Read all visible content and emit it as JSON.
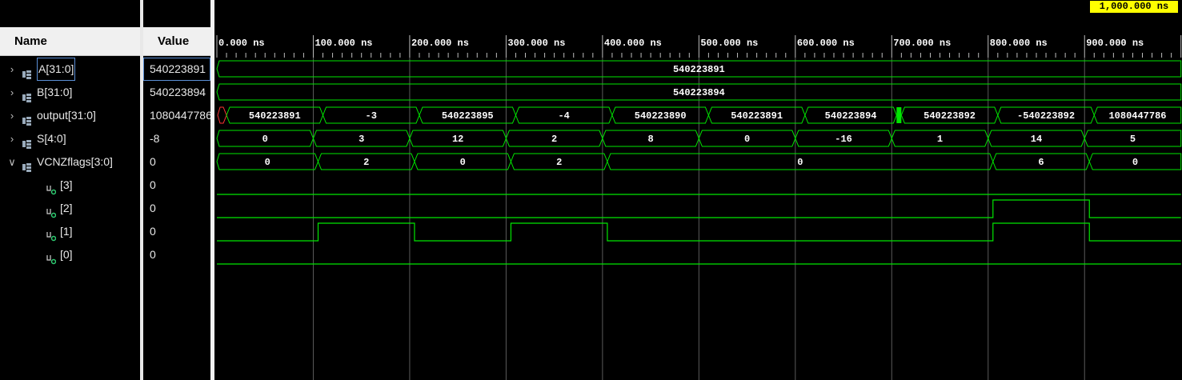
{
  "header": {
    "name_label": "Name",
    "value_label": "Value"
  },
  "cursor": {
    "time_label": "1,000.000 ns"
  },
  "timeline": {
    "unit": "ns",
    "start": 0,
    "end": 1000,
    "ticks": [
      "0.000 ns",
      "100.000 ns",
      "200.000 ns",
      "300.000 ns",
      "400.000 ns",
      "500.000 ns",
      "600.000 ns",
      "700.000 ns",
      "800.000 ns",
      "900.000 ns"
    ]
  },
  "colors": {
    "wave": "#00e600",
    "bg": "#000000",
    "grid": "#5a5a5a",
    "cursor_bg": "#ffff00",
    "x_state": "#ff3333",
    "selection": "#5b8fd6"
  },
  "icons": {
    "bus": "bus-signal-icon",
    "bit": "bit-signal-icon",
    "expand": "chevron-right-icon",
    "collapse": "chevron-down-icon"
  },
  "signals": [
    {
      "name": "A[31:0]",
      "value": "540223891",
      "kind": "bus",
      "expanded": false,
      "selected": true,
      "segments": [
        {
          "t0": 0,
          "t1": 1000,
          "label": "540223891"
        }
      ]
    },
    {
      "name": "B[31:0]",
      "value": "540223894",
      "kind": "bus",
      "expanded": false,
      "segments": [
        {
          "t0": 0,
          "t1": 1000,
          "label": "540223894"
        }
      ]
    },
    {
      "name": "output[31:0]",
      "value": "1080447786",
      "kind": "bus",
      "expanded": false,
      "segments": [
        {
          "t0": 0,
          "t1": 10,
          "label": "",
          "state": "X"
        },
        {
          "t0": 10,
          "t1": 110,
          "label": "540223891"
        },
        {
          "t0": 110,
          "t1": 210,
          "label": "-3"
        },
        {
          "t0": 210,
          "t1": 310,
          "label": "540223895"
        },
        {
          "t0": 310,
          "t1": 410,
          "label": "-4"
        },
        {
          "t0": 410,
          "t1": 510,
          "label": "540223890"
        },
        {
          "t0": 510,
          "t1": 610,
          "label": "540223891"
        },
        {
          "t0": 610,
          "t1": 705,
          "label": "540223894"
        },
        {
          "t0": 705,
          "t1": 710,
          "label": "",
          "state": "glitch"
        },
        {
          "t0": 710,
          "t1": 810,
          "label": "540223892"
        },
        {
          "t0": 810,
          "t1": 910,
          "label": "-540223892"
        },
        {
          "t0": 910,
          "t1": 1000,
          "label": "1080447786"
        }
      ]
    },
    {
      "name": "S[4:0]",
      "value": "-8",
      "kind": "bus",
      "expanded": false,
      "segments": [
        {
          "t0": 0,
          "t1": 100,
          "label": "0"
        },
        {
          "t0": 100,
          "t1": 200,
          "label": "3"
        },
        {
          "t0": 200,
          "t1": 300,
          "label": "12"
        },
        {
          "t0": 300,
          "t1": 400,
          "label": "2"
        },
        {
          "t0": 400,
          "t1": 500,
          "label": "8"
        },
        {
          "t0": 500,
          "t1": 600,
          "label": "0"
        },
        {
          "t0": 600,
          "t1": 700,
          "label": "-16"
        },
        {
          "t0": 700,
          "t1": 800,
          "label": "1"
        },
        {
          "t0": 800,
          "t1": 900,
          "label": "14"
        },
        {
          "t0": 900,
          "t1": 1000,
          "label": "5"
        }
      ]
    },
    {
      "name": "VCNZflags[3:0]",
      "value": "0",
      "kind": "bus",
      "expanded": true,
      "segments": [
        {
          "t0": 0,
          "t1": 105,
          "label": "0"
        },
        {
          "t0": 105,
          "t1": 205,
          "label": "2"
        },
        {
          "t0": 205,
          "t1": 305,
          "label": "0"
        },
        {
          "t0": 305,
          "t1": 405,
          "label": "2"
        },
        {
          "t0": 405,
          "t1": 805,
          "label": "0"
        },
        {
          "t0": 805,
          "t1": 905,
          "label": "6"
        },
        {
          "t0": 905,
          "t1": 1000,
          "label": "0"
        }
      ]
    },
    {
      "name": "[3]",
      "value": "0",
      "kind": "bit",
      "child": true,
      "transitions": [
        {
          "t": 0,
          "v": 0
        }
      ]
    },
    {
      "name": "[2]",
      "value": "0",
      "kind": "bit",
      "child": true,
      "transitions": [
        {
          "t": 0,
          "v": 0
        },
        {
          "t": 805,
          "v": 1
        },
        {
          "t": 905,
          "v": 0
        }
      ]
    },
    {
      "name": "[1]",
      "value": "0",
      "kind": "bit",
      "child": true,
      "transitions": [
        {
          "t": 0,
          "v": 0
        },
        {
          "t": 105,
          "v": 1
        },
        {
          "t": 205,
          "v": 0
        },
        {
          "t": 305,
          "v": 1
        },
        {
          "t": 405,
          "v": 0
        },
        {
          "t": 805,
          "v": 1
        },
        {
          "t": 905,
          "v": 0
        }
      ]
    },
    {
      "name": "[0]",
      "value": "0",
      "kind": "bit",
      "child": true,
      "transitions": [
        {
          "t": 0,
          "v": 0
        }
      ]
    }
  ]
}
